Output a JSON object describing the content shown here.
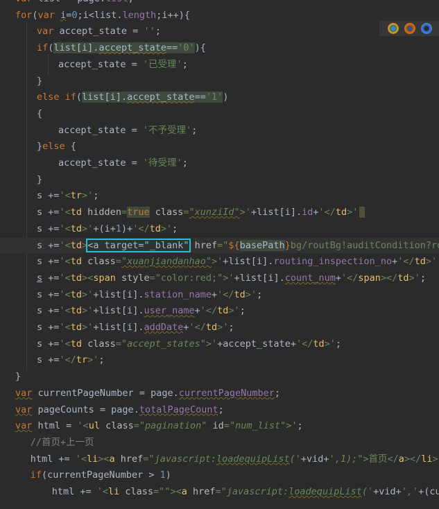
{
  "code": {
    "lines": [
      {
        "indent": 0,
        "parts": [
          {
            "c": "kw",
            "t": "var"
          },
          {
            "t": " list = page."
          },
          {
            "c": "prop",
            "t": "list"
          },
          {
            "t": ";"
          }
        ]
      },
      {
        "indent": 0,
        "parts": [
          {
            "c": "kw",
            "t": "for"
          },
          {
            "t": "("
          },
          {
            "c": "kw",
            "t": "var"
          },
          {
            "t": " "
          },
          {
            "c": "u",
            "t": "i"
          },
          {
            "t": "="
          },
          {
            "c": "num",
            "t": "0"
          },
          {
            "t": ";i<list."
          },
          {
            "c": "prop",
            "t": "length"
          },
          {
            "t": ";i++){"
          }
        ]
      },
      {
        "indent": 1,
        "parts": [
          {
            "c": "kw",
            "t": "var"
          },
          {
            "t": " accept_state = "
          },
          {
            "c": "str",
            "t": "''"
          },
          {
            "t": ";"
          }
        ]
      },
      {
        "indent": 1,
        "parts": [
          {
            "c": "kw",
            "t": "if"
          },
          {
            "t": "("
          },
          {
            "c": "hlbg",
            "t": "list[i]."
          },
          {
            "c": "hlbg u",
            "t": "accept_state"
          },
          {
            "c": "hlbg",
            "t": "=="
          },
          {
            "c": "hlbg str",
            "t": "'0'"
          },
          {
            "t": "){"
          }
        ]
      },
      {
        "indent": 2,
        "parts": [
          {
            "t": "accept_state = "
          },
          {
            "c": "str",
            "t": "'已受理'"
          },
          {
            "t": ";"
          }
        ]
      },
      {
        "indent": 1,
        "parts": [
          {
            "t": "}"
          }
        ]
      },
      {
        "indent": 1,
        "parts": [
          {
            "c": "kw",
            "t": "else if"
          },
          {
            "t": "("
          },
          {
            "c": "hlbg",
            "t": "list[i]."
          },
          {
            "c": "hlbg u",
            "t": "accept_state"
          },
          {
            "c": "hlbg",
            "t": "=="
          },
          {
            "c": "hlbg str",
            "t": "'1'"
          },
          {
            "t": ")"
          }
        ]
      },
      {
        "indent": 1,
        "parts": [
          {
            "t": "{"
          }
        ]
      },
      {
        "indent": 2,
        "parts": [
          {
            "t": "accept_state = "
          },
          {
            "c": "str",
            "t": "'不予受理'"
          },
          {
            "t": ";"
          }
        ]
      },
      {
        "indent": 1,
        "parts": [
          {
            "t": "}"
          },
          {
            "c": "kw",
            "t": "else"
          },
          {
            "t": " {"
          }
        ]
      },
      {
        "indent": 2,
        "parts": [
          {
            "t": "accept_state = "
          },
          {
            "c": "str",
            "t": "'待受理'"
          },
          {
            "t": ";"
          }
        ]
      },
      {
        "indent": 1,
        "parts": [
          {
            "t": "}"
          }
        ]
      },
      {
        "indent": 1,
        "parts": [
          {
            "t": "s +="
          },
          {
            "c": "str",
            "t": "'<"
          },
          {
            "c": "tag",
            "t": "tr"
          },
          {
            "c": "str",
            "t": ">'"
          },
          {
            "t": ";"
          }
        ]
      },
      {
        "indent": 1,
        "parts": [
          {
            "t": "s +="
          },
          {
            "c": "str",
            "t": "'<"
          },
          {
            "c": "tag",
            "t": "td"
          },
          {
            "c": "attr",
            "t": " hidden"
          },
          {
            "c": "str",
            "t": "="
          },
          {
            "c": "kw hlbg",
            "t": "true"
          },
          {
            "c": "attr",
            "t": " class"
          },
          {
            "c": "str",
            "t": "="
          },
          {
            "c": "val u",
            "t": "\"xunziId\""
          },
          {
            "c": "str",
            "t": ">'"
          },
          {
            "t": "+list[i]."
          },
          {
            "c": "prop",
            "t": "id"
          },
          {
            "t": "+"
          },
          {
            "c": "str",
            "t": "'</"
          },
          {
            "c": "tag",
            "t": "td"
          },
          {
            "c": "str",
            "t": ">'"
          },
          {
            "c": "marker",
            "t": ""
          }
        ]
      },
      {
        "indent": 1,
        "parts": [
          {
            "t": "s +="
          },
          {
            "c": "str",
            "t": "'<"
          },
          {
            "c": "tag",
            "t": "td"
          },
          {
            "c": "str",
            "t": ">'"
          },
          {
            "t": "+(i+"
          },
          {
            "c": "num",
            "t": "1"
          },
          {
            "t": ")+"
          },
          {
            "c": "str",
            "t": "'</"
          },
          {
            "c": "tag",
            "t": "td"
          },
          {
            "c": "str",
            "t": ">'"
          },
          {
            "t": ";"
          }
        ]
      },
      {
        "indent": 1,
        "hl": true,
        "parts": [
          {
            "t": "s +="
          },
          {
            "c": "str",
            "t": "'<"
          },
          {
            "c": "tag",
            "t": "td"
          },
          {
            "c": "str",
            "t": ">"
          },
          {
            "c": "sel",
            "t": "<a target=\"_blank\""
          },
          {
            "c": "attr",
            "t": " href"
          },
          {
            "c": "str",
            "t": "=\""
          },
          {
            "c": "kw",
            "t": "${"
          },
          {
            "c": "hlbg",
            "t": "basePath"
          },
          {
            "c": "kw",
            "t": "}"
          },
          {
            "c": "str",
            "t": "bg/routBg!auditCondition?ro"
          }
        ]
      },
      {
        "indent": 1,
        "parts": [
          {
            "t": "s +="
          },
          {
            "c": "str",
            "t": "'<"
          },
          {
            "c": "tag",
            "t": "td"
          },
          {
            "c": "attr",
            "t": " class"
          },
          {
            "c": "str",
            "t": "="
          },
          {
            "c": "val u",
            "t": "\"xuanjiandanhao\""
          },
          {
            "c": "str",
            "t": ">'"
          },
          {
            "t": "+list[i]."
          },
          {
            "c": "prop",
            "t": "routing_inspection_no"
          },
          {
            "t": "+"
          },
          {
            "c": "str",
            "t": "'</"
          },
          {
            "c": "tag",
            "t": "td"
          },
          {
            "c": "str",
            "t": ">'"
          },
          {
            "t": ";"
          }
        ]
      },
      {
        "indent": 1,
        "parts": [
          {
            "c": "ubl",
            "t": "s"
          },
          {
            "t": " +="
          },
          {
            "c": "str",
            "t": "'<"
          },
          {
            "c": "tag",
            "t": "td"
          },
          {
            "c": "str",
            "t": "><"
          },
          {
            "c": "tag",
            "t": "span"
          },
          {
            "c": "attr",
            "t": " style"
          },
          {
            "c": "str",
            "t": "=\"color:red;\">'"
          },
          {
            "t": "+list[i]."
          },
          {
            "c": "prop u",
            "t": "count_num"
          },
          {
            "t": "+"
          },
          {
            "c": "str",
            "t": "'</"
          },
          {
            "c": "tag",
            "t": "span"
          },
          {
            "c": "str",
            "t": "></"
          },
          {
            "c": "tag",
            "t": "td"
          },
          {
            "c": "str",
            "t": ">'"
          },
          {
            "t": ";"
          }
        ]
      },
      {
        "indent": 1,
        "parts": [
          {
            "t": "s +="
          },
          {
            "c": "str",
            "t": "'<"
          },
          {
            "c": "tag",
            "t": "td"
          },
          {
            "c": "str",
            "t": ">'"
          },
          {
            "t": "+list[i]."
          },
          {
            "c": "prop",
            "t": "station_name"
          },
          {
            "t": "+"
          },
          {
            "c": "str",
            "t": "'</"
          },
          {
            "c": "tag",
            "t": "td"
          },
          {
            "c": "str",
            "t": ">'"
          },
          {
            "t": ";"
          }
        ]
      },
      {
        "indent": 1,
        "parts": [
          {
            "t": "s +="
          },
          {
            "c": "str",
            "t": "'<"
          },
          {
            "c": "tag",
            "t": "td"
          },
          {
            "c": "str",
            "t": ">'"
          },
          {
            "t": "+list[i]."
          },
          {
            "c": "prop u",
            "t": "user_name"
          },
          {
            "t": "+"
          },
          {
            "c": "str",
            "t": "'</"
          },
          {
            "c": "tag",
            "t": "td"
          },
          {
            "c": "str",
            "t": ">'"
          },
          {
            "t": ";"
          }
        ]
      },
      {
        "indent": 1,
        "parts": [
          {
            "t": "s +="
          },
          {
            "c": "str",
            "t": "'<"
          },
          {
            "c": "tag",
            "t": "td"
          },
          {
            "c": "str",
            "t": ">'"
          },
          {
            "t": "+list[i]."
          },
          {
            "c": "prop u",
            "t": "addDate"
          },
          {
            "t": "+"
          },
          {
            "c": "str",
            "t": "'</"
          },
          {
            "c": "tag",
            "t": "td"
          },
          {
            "c": "str",
            "t": ">'"
          },
          {
            "t": ";"
          }
        ]
      },
      {
        "indent": 1,
        "parts": [
          {
            "t": "s +="
          },
          {
            "c": "str",
            "t": "'<"
          },
          {
            "c": "tag",
            "t": "td"
          },
          {
            "c": "attr",
            "t": " class"
          },
          {
            "c": "str",
            "t": "="
          },
          {
            "c": "val",
            "t": "\"accept_states\""
          },
          {
            "c": "str",
            "t": ">'"
          },
          {
            "t": "+accept_state+"
          },
          {
            "c": "str",
            "t": "'</"
          },
          {
            "c": "tag",
            "t": "td"
          },
          {
            "c": "str",
            "t": ">'"
          },
          {
            "t": ";"
          }
        ]
      },
      {
        "indent": 1,
        "parts": [
          {
            "t": "s +="
          },
          {
            "c": "str",
            "t": "'</"
          },
          {
            "c": "tag",
            "t": "tr"
          },
          {
            "c": "str",
            "t": ">'"
          },
          {
            "t": ";"
          }
        ]
      },
      {
        "indent": 0,
        "parts": [
          {
            "t": "}"
          }
        ]
      },
      {
        "indent": 0,
        "parts": [
          {
            "c": "kw u",
            "t": "var"
          },
          {
            "t": " currentPageNumber = page."
          },
          {
            "c": "prop u",
            "t": "currentPageNumber"
          },
          {
            "t": ";"
          }
        ]
      },
      {
        "indent": 0,
        "parts": [
          {
            "c": "kw u",
            "t": "var"
          },
          {
            "t": " pageCounts = page."
          },
          {
            "c": "prop u",
            "t": "totalPageCount"
          },
          {
            "t": ";"
          }
        ]
      },
      {
        "indent": 0,
        "parts": [
          {
            "c": "kw u",
            "t": "var"
          },
          {
            "t": " html = "
          },
          {
            "c": "str",
            "t": "'<"
          },
          {
            "c": "tag",
            "t": "ul"
          },
          {
            "c": "attr",
            "t": " class"
          },
          {
            "c": "str",
            "t": "="
          },
          {
            "c": "val",
            "t": "\"pagination\""
          },
          {
            "c": "attr",
            "t": " id"
          },
          {
            "c": "str",
            "t": "="
          },
          {
            "c": "val",
            "t": "\"num_list\""
          },
          {
            "c": "str",
            "t": ">'"
          },
          {
            "t": ";"
          }
        ]
      },
      {
        "indent": 0.7,
        "parts": [
          {
            "c": "cmt",
            "t": "//首页+上一页"
          }
        ]
      },
      {
        "indent": 0.7,
        "parts": [
          {
            "t": "html += "
          },
          {
            "c": "str",
            "t": "'<"
          },
          {
            "c": "tag",
            "t": "li"
          },
          {
            "c": "str",
            "t": "><"
          },
          {
            "c": "tag",
            "t": "a"
          },
          {
            "c": "attr",
            "t": " href"
          },
          {
            "c": "str",
            "t": "="
          },
          {
            "c": "val",
            "t": "\"javascript:"
          },
          {
            "c": "val u",
            "t": "loadequipList"
          },
          {
            "c": "val",
            "t": "('"
          },
          {
            "t": "+vid+"
          },
          {
            "c": "val",
            "t": "',1);\""
          },
          {
            "c": "str",
            "t": ">首页</"
          },
          {
            "c": "tag",
            "t": "a"
          },
          {
            "c": "str",
            "t": "></"
          },
          {
            "c": "tag",
            "t": "li"
          },
          {
            "c": "str",
            "t": ">'"
          }
        ]
      },
      {
        "indent": 0.7,
        "parts": [
          {
            "c": "kw",
            "t": "if"
          },
          {
            "t": "(currentPageNumber > "
          },
          {
            "c": "num",
            "t": "1"
          },
          {
            "t": ")"
          }
        ]
      },
      {
        "indent": 1.7,
        "parts": [
          {
            "t": "html += "
          },
          {
            "c": "str",
            "t": "'<"
          },
          {
            "c": "tag",
            "t": "li"
          },
          {
            "c": "attr",
            "t": " class"
          },
          {
            "c": "str",
            "t": "="
          },
          {
            "c": "val",
            "t": "\"\""
          },
          {
            "c": "str",
            "t": "><"
          },
          {
            "c": "tag",
            "t": "a"
          },
          {
            "c": "attr",
            "t": " href"
          },
          {
            "c": "str",
            "t": "="
          },
          {
            "c": "val",
            "t": "\"javascript:"
          },
          {
            "c": "val u",
            "t": "loadequipList"
          },
          {
            "c": "val",
            "t": "('"
          },
          {
            "t": "+vid+"
          },
          {
            "c": "val",
            "t": "','"
          },
          {
            "t": "+(cur"
          }
        ]
      }
    ]
  },
  "browser_icons": [
    "chrome-icon",
    "firefox-icon",
    "opera-icon"
  ]
}
